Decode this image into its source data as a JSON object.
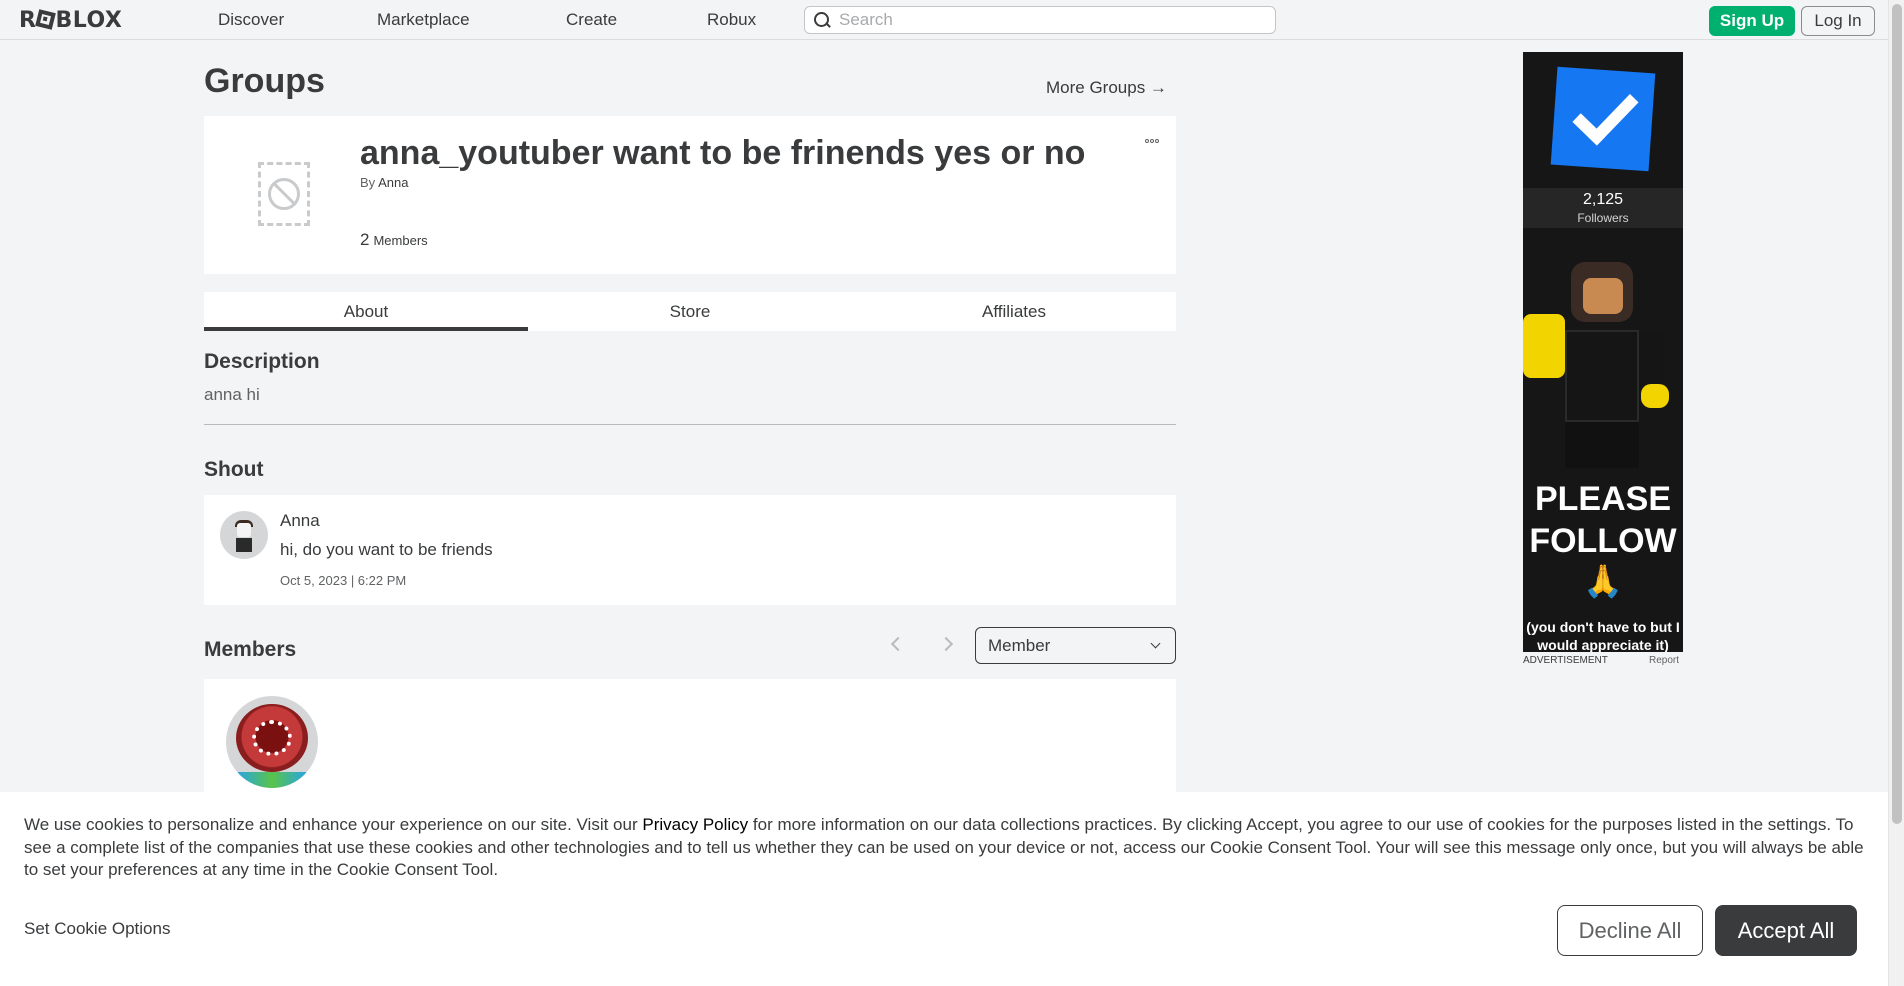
{
  "nav": {
    "logo_text_pre": "R",
    "logo_text_post": "BLOX",
    "links": [
      "Discover",
      "Marketplace",
      "Create",
      "Robux"
    ],
    "search_placeholder": "Search",
    "signup_label": "Sign Up",
    "login_label": "Log In"
  },
  "page": {
    "title": "Groups",
    "more_groups": "More Groups →"
  },
  "group": {
    "name": "anna_youtuber want to be frinends yes or no",
    "by_prefix": "By",
    "owner": "Anna",
    "member_count": "2",
    "members_label": "Members"
  },
  "tabs": [
    "About",
    "Store",
    "Affiliates"
  ],
  "about": {
    "description_heading": "Description",
    "description": "anna hi",
    "shout_heading": "Shout",
    "shout": {
      "author": "Anna",
      "message": "hi, do you want to be friends",
      "date": "Oct 5, 2023 | 6:22 PM"
    },
    "members_heading": "Members",
    "role_selected": "Member"
  },
  "ad": {
    "followers": "2,125",
    "followers_label": "Followers",
    "headline_1": "PLEASE",
    "headline_2": "FOLLOW",
    "emoji": "🙏",
    "note": "(you don't have to but I would appreciate it)",
    "label": "ADVERTISEMENT",
    "report": "Report"
  },
  "cookie": {
    "text_before": "We use cookies to personalize and enhance your experience on our site. Visit our ",
    "privacy_link": "Privacy Policy",
    "text_after": " for more information on our data collections practices. By clicking Accept, you agree to our use of cookies for the purposes listed in the settings. To see a complete list of the companies that use these cookies and other technologies and to tell us whether they can be used on your device or not, access our Cookie Consent Tool. Your will see this message only once, but you will always be able to set your preferences at any time in the Cookie Consent Tool.",
    "options_label": "Set Cookie Options",
    "decline_label": "Decline All",
    "accept_label": "Accept All"
  },
  "colors": {
    "signup_green": "#00b06f",
    "ad_check_blue": "#1677f2",
    "accept_dark": "#393b3d"
  }
}
